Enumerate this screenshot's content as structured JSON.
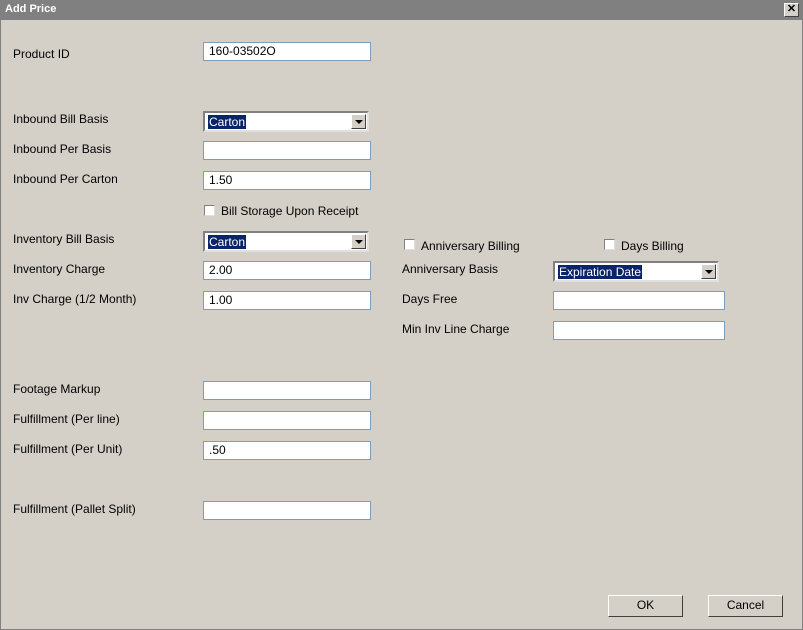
{
  "window": {
    "title": "Add Price",
    "close_glyph": "✕"
  },
  "form": {
    "product_id": {
      "label": "Product ID",
      "value": "160-03502O"
    },
    "inbound_bill_basis": {
      "label": "Inbound Bill Basis",
      "value": "Carton"
    },
    "inbound_per_basis": {
      "label": "Inbound Per Basis",
      "value": ""
    },
    "inbound_per_carton": {
      "label": "Inbound Per Carton",
      "value": "1.50"
    },
    "bill_storage_upon_receipt": {
      "label": "Bill Storage Upon Receipt",
      "checked": false
    },
    "inventory_bill_basis": {
      "label": "Inventory Bill Basis",
      "value": "Carton"
    },
    "inventory_charge": {
      "label": "Inventory Charge",
      "value": "2.00"
    },
    "inv_charge_half_month": {
      "label": "Inv Charge (1/2 Month)",
      "value": "1.00"
    },
    "anniversary_billing": {
      "label": "Anniversary Billing",
      "checked": false
    },
    "days_billing": {
      "label": "Days Billing",
      "checked": false
    },
    "anniversary_basis": {
      "label": "Anniversary Basis",
      "value": "Expiration Date"
    },
    "days_free": {
      "label": "Days Free",
      "value": ""
    },
    "min_inv_line_charge": {
      "label": "Min Inv Line Charge",
      "value": ""
    },
    "footage_markup": {
      "label": "Footage Markup",
      "value": ""
    },
    "fulfillment_per_line": {
      "label": "Fulfillment (Per line)",
      "value": ""
    },
    "fulfillment_per_unit": {
      "label": "Fulfillment (Per Unit)",
      "value": ".50"
    },
    "fulfillment_pallet_split": {
      "label": "Fulfillment (Pallet Split)",
      "value": ""
    }
  },
  "buttons": {
    "ok": "OK",
    "cancel": "Cancel"
  }
}
